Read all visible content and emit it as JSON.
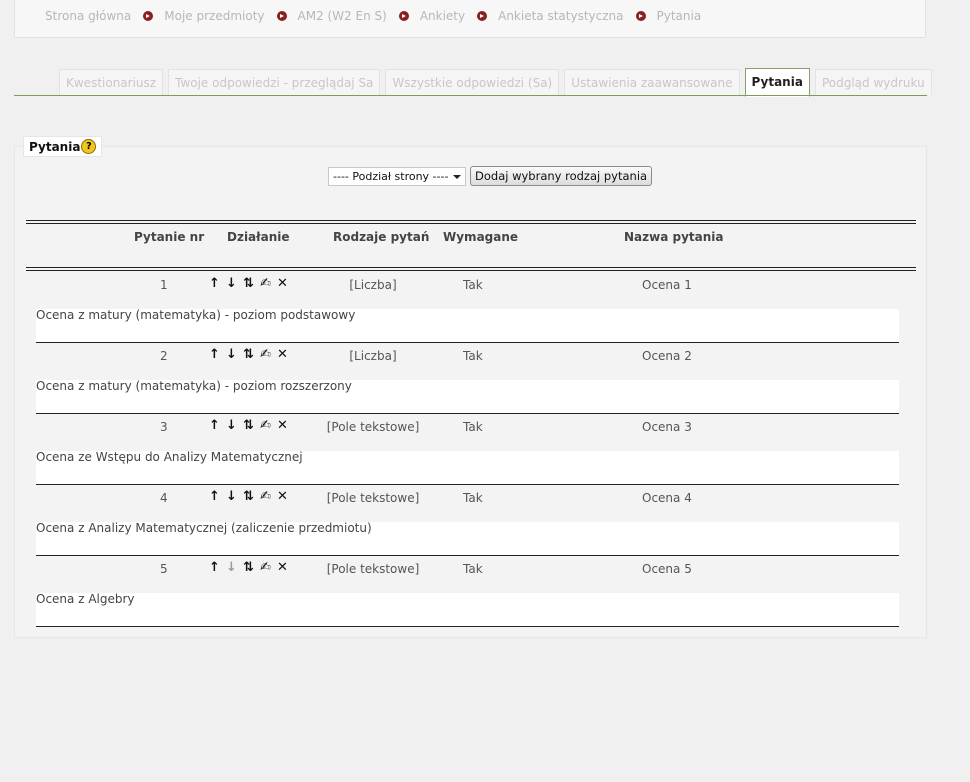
{
  "breadcrumb": [
    "Strona główna",
    "Moje przedmioty",
    "AM2 (W2 En S)",
    "Ankiety",
    "Ankieta statystyczna",
    "Pytania"
  ],
  "tabs": [
    {
      "label": "Kwestionariusz",
      "active": false
    },
    {
      "label": "Twoje odpowiedzi - przeglądaj Sa",
      "active": false
    },
    {
      "label": "Wszystkie odpowiedzi (Sa)",
      "active": false
    },
    {
      "label": "Ustawienia zaawansowane",
      "active": false
    },
    {
      "label": "Pytania",
      "active": true
    },
    {
      "label": "Podgląd wydruku",
      "active": false
    }
  ],
  "panel": {
    "legend": "Pytania",
    "select_value": "---- Podział strony ----",
    "add_button": "Dodaj wybrany rodzaj pytania"
  },
  "table": {
    "headers": [
      "Pytanie nr",
      "Działanie",
      "Rodzaje pytań",
      "Wymagane",
      "Nazwa pytania"
    ],
    "rows": [
      {
        "num": "1",
        "type": "[Liczba]",
        "required": "Tak",
        "name": "Ocena 1",
        "desc": "Ocena z matury (matematyka) - poziom podstawowy",
        "down_enabled": true
      },
      {
        "num": "2",
        "type": "[Liczba]",
        "required": "Tak",
        "name": "Ocena 2",
        "desc": "Ocena z matury (matematyka) - poziom rozszerzony",
        "down_enabled": true
      },
      {
        "num": "3",
        "type": "[Pole tekstowe]",
        "required": "Tak",
        "name": "Ocena 3",
        "desc": "Ocena ze Wstępu do Analizy Matematycznej",
        "down_enabled": true
      },
      {
        "num": "4",
        "type": "[Pole tekstowe]",
        "required": "Tak",
        "name": "Ocena 4",
        "desc": "Ocena z Analizy Matematycznej (zaliczenie przedmiotu)",
        "down_enabled": true
      },
      {
        "num": "5",
        "type": "[Pole tekstowe]",
        "required": "Tak",
        "name": "Ocena 5",
        "desc": "Ocena z Algebry",
        "down_enabled": false
      }
    ]
  },
  "icons": {
    "up": "↑",
    "down": "↓",
    "move": "⇅",
    "edit": "✍",
    "delete": "✕"
  },
  "colors": {
    "accent_line": "#7e9a5c",
    "separator_dot": "#8a1f1f",
    "help": "#f3c71a"
  }
}
